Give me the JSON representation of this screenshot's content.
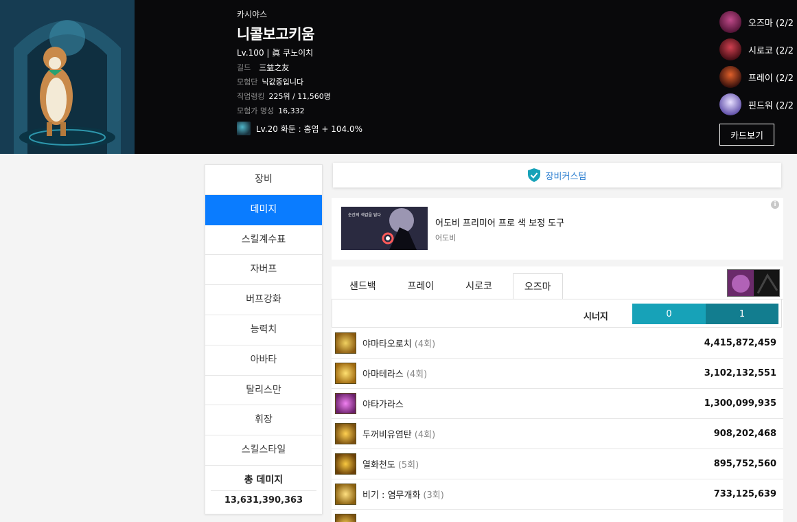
{
  "character": {
    "server": "카시야스",
    "name": "니콜보고키움",
    "level_line": "Lv.100 | 眞 쿠노이치",
    "info": [
      {
        "key": "길드",
        "value": "三益之友",
        "kind": "guild"
      },
      {
        "key": "모험단",
        "value": "닉값중입니다",
        "kind": ""
      },
      {
        "key": "직업랭킹",
        "value": "225위 / 11,560명",
        "kind": ""
      },
      {
        "key": "모험가 명성",
        "value": "16,332",
        "kind": ""
      }
    ],
    "title_text": "Lv.20 화둔 : 홍염 + 104.0%"
  },
  "party": [
    {
      "name": "오즈마 (2/2",
      "color": "#7a2a5a"
    },
    {
      "name": "시로코 (2/2",
      "color": "#8a1e28"
    },
    {
      "name": "프레이 (2/2",
      "color": "#a03a1c"
    },
    {
      "name": "핀드워 (2/2",
      "color": "#9a8ad8"
    }
  ],
  "card_button": "카드보기",
  "side_menu": {
    "items": [
      "장비",
      "데미지",
      "스킬계수표",
      "자버프",
      "버프강화",
      "능력치",
      "아바타",
      "탈리스만",
      "휘장",
      "스킬스타일"
    ],
    "active_index": 1,
    "total_label": "총 데미지",
    "total_value": "13,631,390,363"
  },
  "custom_bar": {
    "label": "장비커스텀",
    "accent": "#17a2b8"
  },
  "ad": {
    "title": "어도비 프리미어 프로 색 보정 도구",
    "sub": "어도비",
    "image_text": "순간의 색감을 담다"
  },
  "tabs": {
    "items": [
      "샌드백",
      "프레이",
      "시로코",
      "오즈마"
    ],
    "active_index": 3
  },
  "synergy": {
    "label": "시너지",
    "options": [
      "0",
      "1"
    ]
  },
  "damage_rows": [
    {
      "name": "야마타오로치",
      "count": "(4회)",
      "value": "4,415,872,459",
      "color": "#c89a2a"
    },
    {
      "name": "아마테라스",
      "count": "(4회)",
      "value": "3,102,132,551",
      "color": "#d8a030"
    },
    {
      "name": "야타가라스",
      "count": "",
      "value": "1,300,099,935",
      "color": "#c060c0"
    },
    {
      "name": "두꺼비유염탄",
      "count": "(4회)",
      "value": "908,202,468",
      "color": "#c08a20"
    },
    {
      "name": "열화천도",
      "count": "(5회)",
      "value": "895,752,560",
      "color": "#b8861c"
    },
    {
      "name": "비기 : 염무개화",
      "count": "(3회)",
      "value": "733,125,639",
      "color": "#d8a838"
    },
    {
      "name": "",
      "count": "",
      "value": "",
      "color": "#c89a2a"
    }
  ]
}
